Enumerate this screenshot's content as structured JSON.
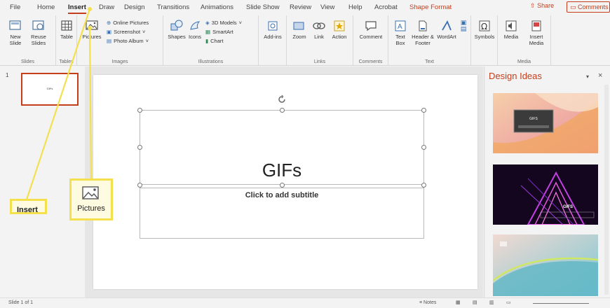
{
  "tabs": [
    "File",
    "Home",
    "Insert",
    "Draw",
    "Design",
    "Transitions",
    "Animations",
    "Slide Show",
    "Review",
    "View",
    "Help",
    "Acrobat",
    "Shape Format"
  ],
  "share_label": "Share",
  "comments_label": "Comments",
  "ribbon": {
    "groups": {
      "slides": "Slides",
      "tables": "Tables",
      "images": "Images",
      "illustrations": "Illustrations",
      "links": "Links",
      "comments": "Comments",
      "text": "Text",
      "media": "Media"
    },
    "new_slide": "New Slide",
    "reuse_slides": "Reuse Slides",
    "table": "Table",
    "pictures": "Pictures",
    "online_pictures": "Online Pictures",
    "screenshot": "Screenshot",
    "photo_album": "Photo Album",
    "shapes": "Shapes",
    "icons": "Icons",
    "models_3d": "3D Models",
    "smartart": "SmartArt",
    "chart": "Chart",
    "addins": "Add-ins",
    "zoom": "Zoom",
    "link": "Link",
    "action": "Action",
    "comment": "Comment",
    "text_box": "Text Box",
    "header_footer": "Header & Footer",
    "wordart": "WordArt",
    "symbols": "Symbols",
    "media": "Media",
    "insert_media": "Insert Media"
  },
  "thumbnail": {
    "number": "1",
    "text": "GIFs"
  },
  "slide": {
    "title": "GIFs",
    "subtitle": "Click to add subtitle"
  },
  "design_ideas": {
    "title": "Design Ideas",
    "card1_title": "GIFS",
    "card2_title": "GIFS"
  },
  "status": {
    "slide_count": "Slide 1 of 1",
    "notes": "Notes"
  },
  "annotations": {
    "insert_label": "Insert",
    "pictures_label": "Pictures"
  },
  "colors": {
    "accent": "#c43e1c",
    "callout": "#f4e04d"
  }
}
